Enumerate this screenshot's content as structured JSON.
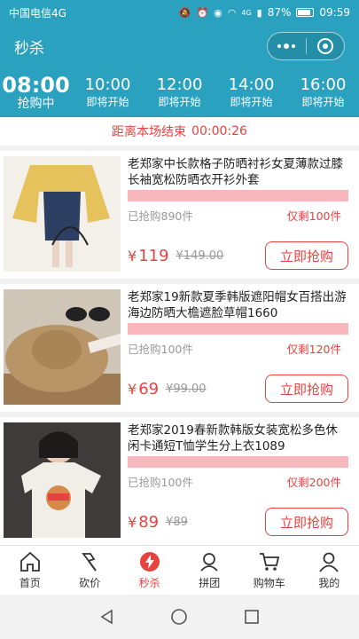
{
  "statusbar": {
    "carrier": "中国电信4G",
    "battery": "87%",
    "time": "09:59",
    "net": "4G"
  },
  "navbar": {
    "title": "秒杀"
  },
  "time_tabs": [
    {
      "time": "08:00",
      "status": "抢购中",
      "active": true
    },
    {
      "time": "10:00",
      "status": "即将开始",
      "active": false
    },
    {
      "time": "12:00",
      "status": "即将开始",
      "active": false
    },
    {
      "time": "14:00",
      "status": "即将开始",
      "active": false
    },
    {
      "time": "16:00",
      "status": "即将开始",
      "active": false
    }
  ],
  "countdown": {
    "label": "距离本场结束",
    "time": "00:00:26"
  },
  "products": [
    {
      "title": "老郑家中长款格子防晒衬衫女夏薄款过膝长袖宽松防晒衣开衫外套",
      "sold": "已抢购890件",
      "remaining": "仅剩100件",
      "currency": "¥",
      "price": "119",
      "original_price": "¥149.00",
      "button": "立即抢购"
    },
    {
      "title": "老郑家19新款夏季韩版遮阳帽女百搭出游海边防晒大檐遮脸草帽1660",
      "sold": "已抢购100件",
      "remaining": "仅剩120件",
      "currency": "¥",
      "price": "69",
      "original_price": "¥99.00",
      "button": "立即抢购"
    },
    {
      "title": "老郑家2019春新款韩版女装宽松多色休闲卡通短T恤学生分上衣1089",
      "sold": "已抢购100件",
      "remaining": "仅剩200件",
      "currency": "¥",
      "price": "89",
      "original_price": "¥89",
      "button": "立即抢购"
    }
  ],
  "tabbar": [
    {
      "label": "首页",
      "icon": "home-icon"
    },
    {
      "label": "砍价",
      "icon": "axe-icon"
    },
    {
      "label": "秒杀",
      "icon": "flash-icon",
      "active": true
    },
    {
      "label": "拼团",
      "icon": "group-icon"
    },
    {
      "label": "购物车",
      "icon": "cart-icon"
    },
    {
      "label": "我的",
      "icon": "user-icon"
    }
  ],
  "colors": {
    "primary": "#2aa2bf",
    "accent": "#e64340",
    "progress": "#f7b7bd"
  }
}
